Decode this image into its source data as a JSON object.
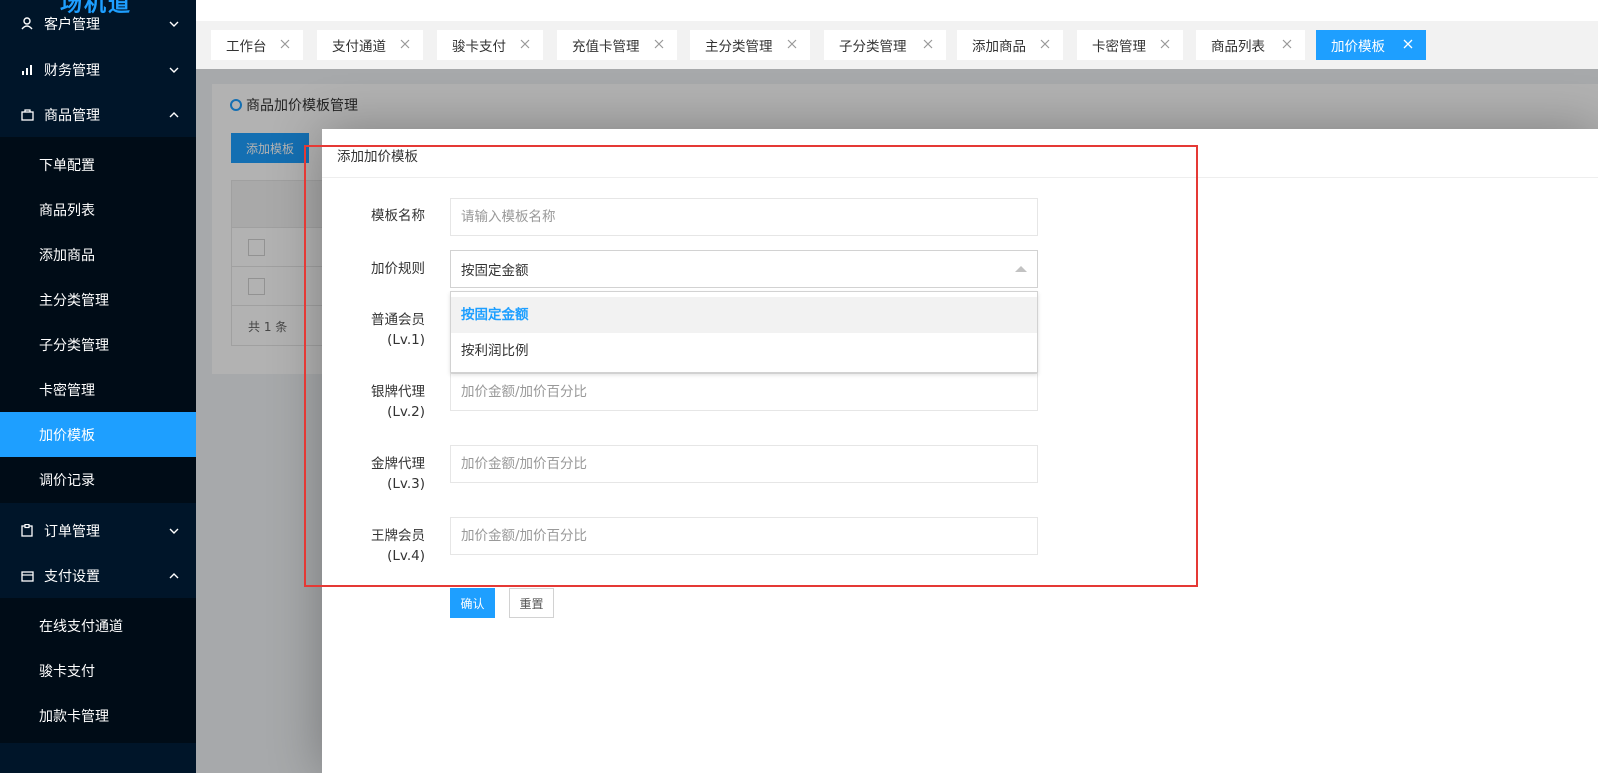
{
  "sidebar": {
    "logo": "场机道",
    "menu": [
      {
        "label": "客户管理",
        "icon": "user-icon",
        "expanded": false
      },
      {
        "label": "财务管理",
        "icon": "bar-chart-icon",
        "expanded": false
      },
      {
        "label": "商品管理",
        "icon": "bag-icon",
        "expanded": true
      },
      {
        "label": "订单管理",
        "icon": "clipboard-icon",
        "expanded": false
      },
      {
        "label": "支付设置",
        "icon": "wallet-icon",
        "expanded": true
      }
    ],
    "goods_sub": [
      "下单配置",
      "商品列表",
      "添加商品",
      "主分类管理",
      "子分类管理",
      "卡密管理",
      "加价模板",
      "调价记录"
    ],
    "pay_sub": [
      "在线支付通道",
      "骏卡支付",
      "加款卡管理"
    ],
    "active_item": "加价模板"
  },
  "tabs": [
    "工作台",
    "支付通道",
    "骏卡支付",
    "充值卡管理",
    "主分类管理",
    "子分类管理",
    "添加商品",
    "卡密管理",
    "商品列表",
    "加价模板"
  ],
  "active_tab": "加价模板",
  "page": {
    "title": "商品加价模板管理",
    "add_button": "添加模板",
    "table_footer": "共 1 条"
  },
  "modal": {
    "title": "添加加价模板",
    "name_label": "模板名称",
    "name_placeholder": "请输入模板名称",
    "rule_label": "加价规则",
    "rule_value": "按固定金额",
    "rule_options": [
      "按固定金额",
      "按利润比例"
    ],
    "levels": [
      {
        "name": "普通会员",
        "level": "(Lv.1)"
      },
      {
        "name": "银牌代理",
        "level": "(Lv.2)"
      },
      {
        "name": "金牌代理",
        "level": "(Lv.3)"
      },
      {
        "name": "王牌会员",
        "level": "(Lv.4)"
      }
    ],
    "amount_placeholder": "加价金额/加价百分比",
    "confirm": "确认",
    "reset": "重置"
  },
  "colors": {
    "accent": "#1e9fff",
    "sidebar": "#001529",
    "highlight": "#e53935"
  }
}
